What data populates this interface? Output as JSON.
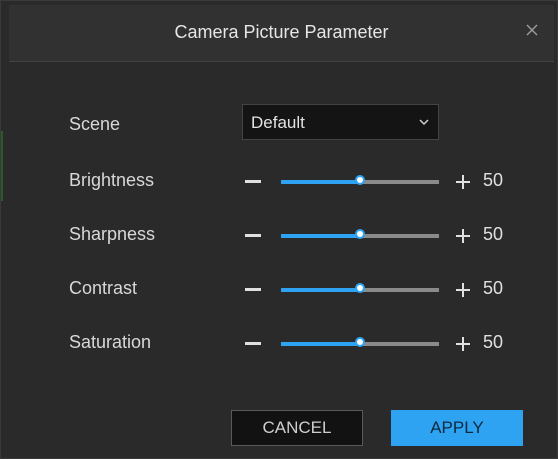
{
  "dialog": {
    "title": "Camera Picture Parameter",
    "close_icon": "close-icon"
  },
  "scene": {
    "label": "Scene",
    "value": "Default",
    "chevron_icon": "chevron-down-icon"
  },
  "sliders": [
    {
      "label": "Brightness",
      "value": "50",
      "level_percent": 50
    },
    {
      "label": "Sharpness",
      "value": "50",
      "level_percent": 50
    },
    {
      "label": "Contrast",
      "value": "50",
      "level_percent": 50
    },
    {
      "label": "Saturation",
      "value": "50",
      "level_percent": 50
    }
  ],
  "buttons": {
    "cancel": "CANCEL",
    "apply": "APPLY"
  },
  "colors": {
    "accent": "#2ea3f2",
    "background": "#2a2a2a",
    "track": "#8a8a8a"
  }
}
